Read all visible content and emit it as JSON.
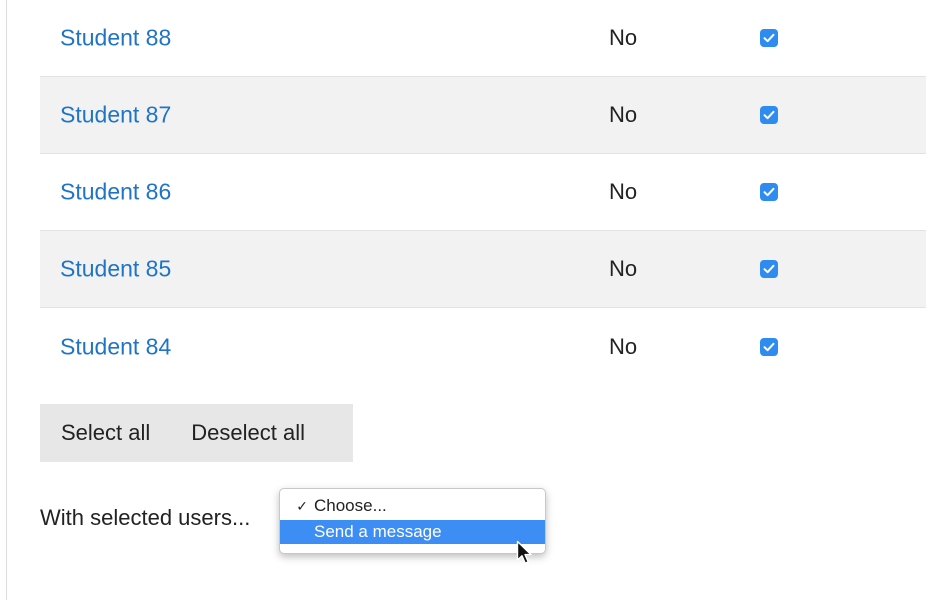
{
  "students": [
    {
      "name": "Student 88",
      "status": "No",
      "checked": true
    },
    {
      "name": "Student 87",
      "status": "No",
      "checked": true
    },
    {
      "name": "Student 86",
      "status": "No",
      "checked": true
    },
    {
      "name": "Student 85",
      "status": "No",
      "checked": true
    },
    {
      "name": "Student 84",
      "status": "No",
      "checked": true
    }
  ],
  "actions": {
    "select_all": "Select all",
    "deselect_all": "Deselect all"
  },
  "bulk": {
    "label": "With selected users...",
    "options": [
      {
        "label": "Choose...",
        "selected": true
      },
      {
        "label": "Send a message",
        "highlighted": true
      }
    ],
    "selected_tick": "✓"
  },
  "colors": {
    "link": "#1f74c6",
    "checkbox": "#2e8cf0",
    "highlight": "#3d8ef4",
    "stripe": "#f2f2f2"
  },
  "icons": {
    "checkbox": "checkmark-icon",
    "cursor": "mouse-pointer-icon"
  }
}
